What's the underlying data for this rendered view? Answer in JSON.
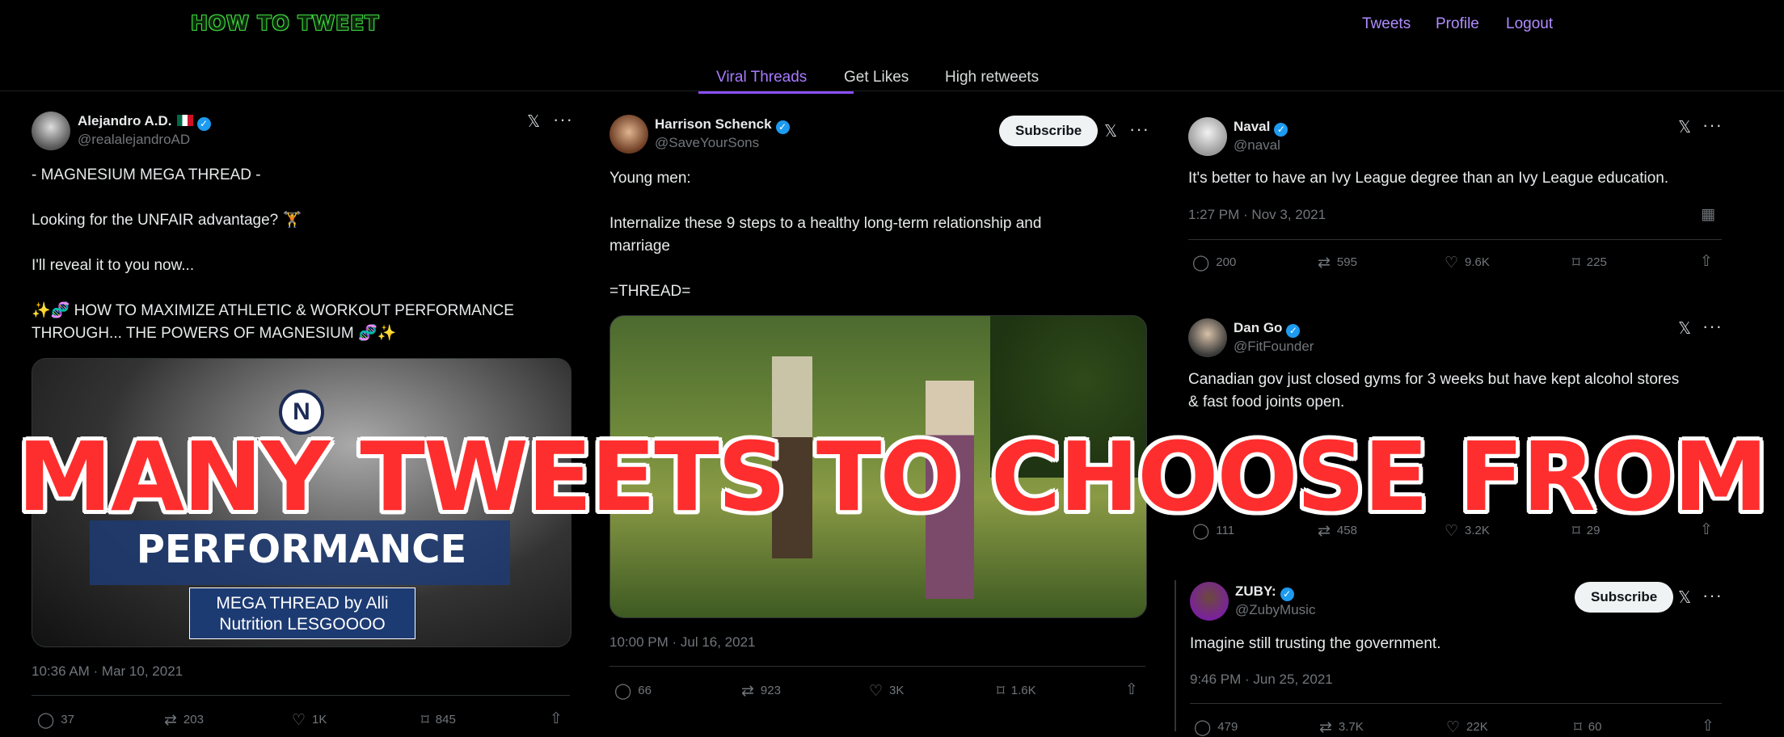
{
  "logo": "HOW TO TWEET",
  "nav": {
    "tweets": "Tweets",
    "profile": "Profile",
    "logout": "Logout"
  },
  "tabs": [
    "Viral Threads",
    "Get Likes",
    "High retweets"
  ],
  "banner": "MANY TWEETS TO CHOOSE FROM",
  "col1": {
    "name": "Alejandro A.D.",
    "handle": "@realalejandroAD",
    "lines": [
      "- MAGNESIUM MEGA THREAD -",
      "Looking for the UNFAIR advantage? 🏋",
      "I'll reveal it to you now...",
      "✨🧬 HOW TO MAXIMIZE ATHLETIC & WORKOUT PERFORMANCE",
      "THROUGH... THE POWERS OF MAGNESIUM 🧬✨"
    ],
    "media_title": "PERFORMANCE",
    "media_sub1": "MEGA THREAD by Alli",
    "media_sub2": "Nutrition LESGOOOO",
    "time": "10:36 AM · Mar 10, 2021",
    "replies": "37",
    "retweets": "203",
    "likes": "1K",
    "bookmarks": "845"
  },
  "col2": {
    "name": "Harrison Schenck",
    "handle": "@SaveYourSons",
    "subscribe": "Subscribe",
    "lines": [
      "Young men:",
      "Internalize these 9 steps to a healthy long-term relationship and",
      "marriage",
      "=THREAD="
    ],
    "time": "10:00 PM · Jul 16, 2021",
    "replies": "66",
    "retweets": "923",
    "likes": "3K",
    "bookmarks": "1.6K"
  },
  "col3a": {
    "name": "Naval",
    "handle": "@naval",
    "text": "It's better to have an Ivy League degree than an Ivy League education.",
    "time": "1:27 PM · Nov 3, 2021",
    "replies": "200",
    "retweets": "595",
    "likes": "9.6K",
    "bookmarks": "225"
  },
  "col3b": {
    "name": "Dan Go",
    "handle": "@FitFounder",
    "line1": "Canadian gov just closed gyms for 3 weeks but have kept alcohol stores",
    "line2": "& fast food joints open.",
    "replies": "111",
    "retweets": "458",
    "likes": "3.2K",
    "bookmarks": "29"
  },
  "col3c": {
    "name": "ZUBY:",
    "handle": "@ZubyMusic",
    "subscribe": "Subscribe",
    "text": "Imagine still trusting the government.",
    "time": "9:46 PM · Jun 25, 2021",
    "replies": "479",
    "retweets": "3.7K",
    "likes": "22K",
    "bookmarks": "60"
  }
}
